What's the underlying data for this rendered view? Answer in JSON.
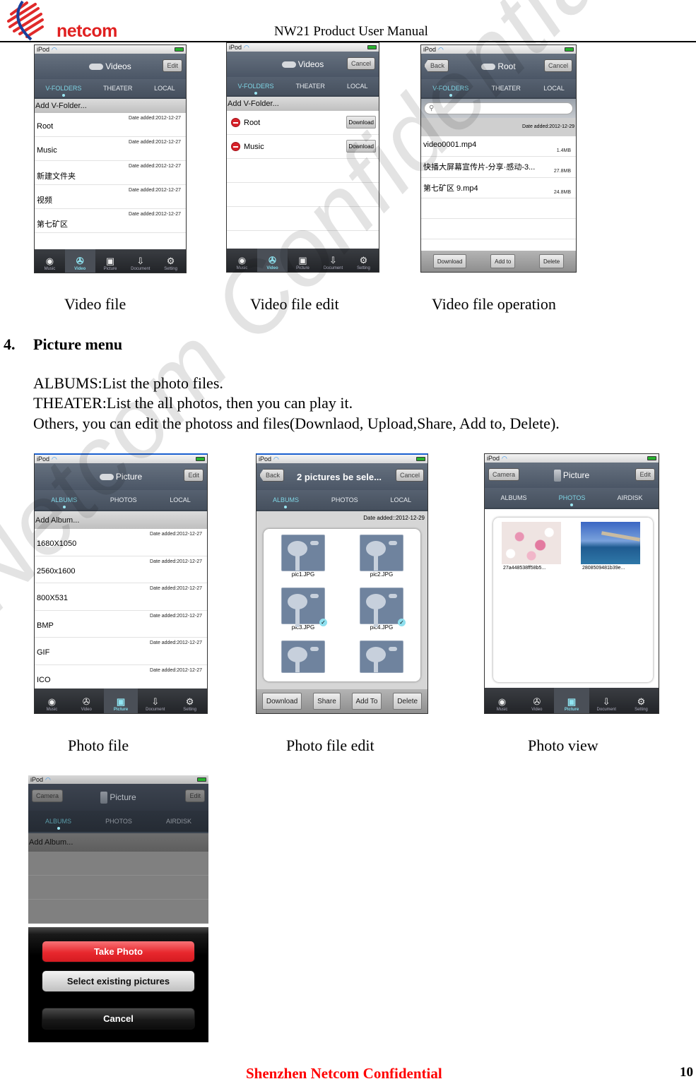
{
  "header": {
    "logo_text": "netcom",
    "title": "NW21 Product User Manual"
  },
  "watermark": "Netcom Confidential",
  "captions": {
    "video_file": "Video file",
    "video_file_edit": "Video file edit",
    "video_file_operation": "Video file operation",
    "photo_file": "Photo file",
    "photo_file_edit": "Photo file edit",
    "photo_view": "Photo view"
  },
  "section": {
    "number": "4.",
    "title": "Picture menu",
    "lines": [
      "ALBUMS:List the photo files.",
      "THEATER:List the all photos, then you can play it.",
      "Others, you can edit the photoss and files(Downlaod, Upload,Share, Add to, Delete)."
    ]
  },
  "footer": {
    "text": "Shenzhen Netcom Confidential",
    "page": "10"
  },
  "common": {
    "status_device": "iPod",
    "tabbar": [
      "Music",
      "Video",
      "Picture",
      "Document",
      "Setting"
    ],
    "video_tabs": [
      "V-FOLDERS",
      "THEATER",
      "LOCAL"
    ],
    "album_tabs": [
      "ALBUMS",
      "PHOTOS",
      "LOCAL"
    ],
    "airdisk_tabs": [
      "ALBUMS",
      "PHOTOS",
      "AIRDISK"
    ]
  },
  "screens": {
    "video_file": {
      "title": "Videos",
      "right_button": "Edit",
      "add_label": "Add V-Folder...",
      "rows": [
        {
          "name": "Root",
          "date": "Date added:2012-12-27"
        },
        {
          "name": "Music",
          "date": "Date added:2012-12-27"
        },
        {
          "name": "新建文件夹",
          "date": "Date added:2012-12-27"
        },
        {
          "name": "视频",
          "date": "Date added:2012-12-27"
        },
        {
          "name": "第七矿区",
          "date": "Date added:2012-12-27"
        }
      ]
    },
    "video_edit": {
      "title": "Videos",
      "right_button": "Cancel",
      "add_label": "Add V-Folder...",
      "rows": [
        {
          "name": "Root",
          "action": "Download"
        },
        {
          "name": "Music",
          "action": "Download"
        }
      ]
    },
    "video_operation": {
      "title": "Root",
      "left_button": "Back",
      "right_button": "Cancel",
      "search_placeholder": "",
      "date": "Date added:2012-12-29",
      "rows": [
        {
          "name": "video0001.mp4",
          "size": "1.4MB"
        },
        {
          "name": "快播大屏幕宣传片-分享·感动-3...",
          "size": "27.8MB"
        },
        {
          "name": "第七矿区 9.mp4",
          "size": "24.8MB"
        }
      ],
      "actions": [
        "Download",
        "Add to",
        "Delete"
      ]
    },
    "photo_file": {
      "title": "Picture",
      "right_button": "Edit",
      "add_label": "Add Album...",
      "rows": [
        {
          "name": "1680X1050",
          "date": "Date added:2012-12-27"
        },
        {
          "name": "2560x1600",
          "date": "Date added:2012-12-27"
        },
        {
          "name": "800X531",
          "date": "Date added:2012-12-27"
        },
        {
          "name": "BMP",
          "date": "Date added:2012-12-27"
        },
        {
          "name": "GIF",
          "date": "Date added:2012-12-27"
        },
        {
          "name": "ICO",
          "date": "Date added:2012-12-27"
        }
      ]
    },
    "photo_edit": {
      "title": "2 pictures be sele...",
      "left_button": "Back",
      "right_button": "Cancel",
      "date": "Date added::2012-12-29",
      "items": [
        {
          "name": "pic1.JPG",
          "selected": false
        },
        {
          "name": "pic2.JPG",
          "selected": false
        },
        {
          "name": "pic3.JPG",
          "selected": true
        },
        {
          "name": "pic4.JPG",
          "selected": true
        },
        {
          "name": "",
          "selected": false
        },
        {
          "name": "",
          "selected": false
        }
      ],
      "actions": [
        "Download",
        "Share",
        "Add To",
        "Delete"
      ]
    },
    "photo_view": {
      "title": "Picture",
      "left_button": "Camera",
      "right_button": "Edit",
      "photos": [
        {
          "name": "27a448538ff58b5..."
        },
        {
          "name": "2808509481b39e..."
        }
      ]
    },
    "photo_camera": {
      "title": "Picture",
      "left_button": "Camera",
      "right_button": "Edit",
      "add_label": "Add Album...",
      "sheet": {
        "take_photo": "Take Photo",
        "select_existing": "Select existing pictures",
        "cancel": "Cancel"
      }
    }
  }
}
